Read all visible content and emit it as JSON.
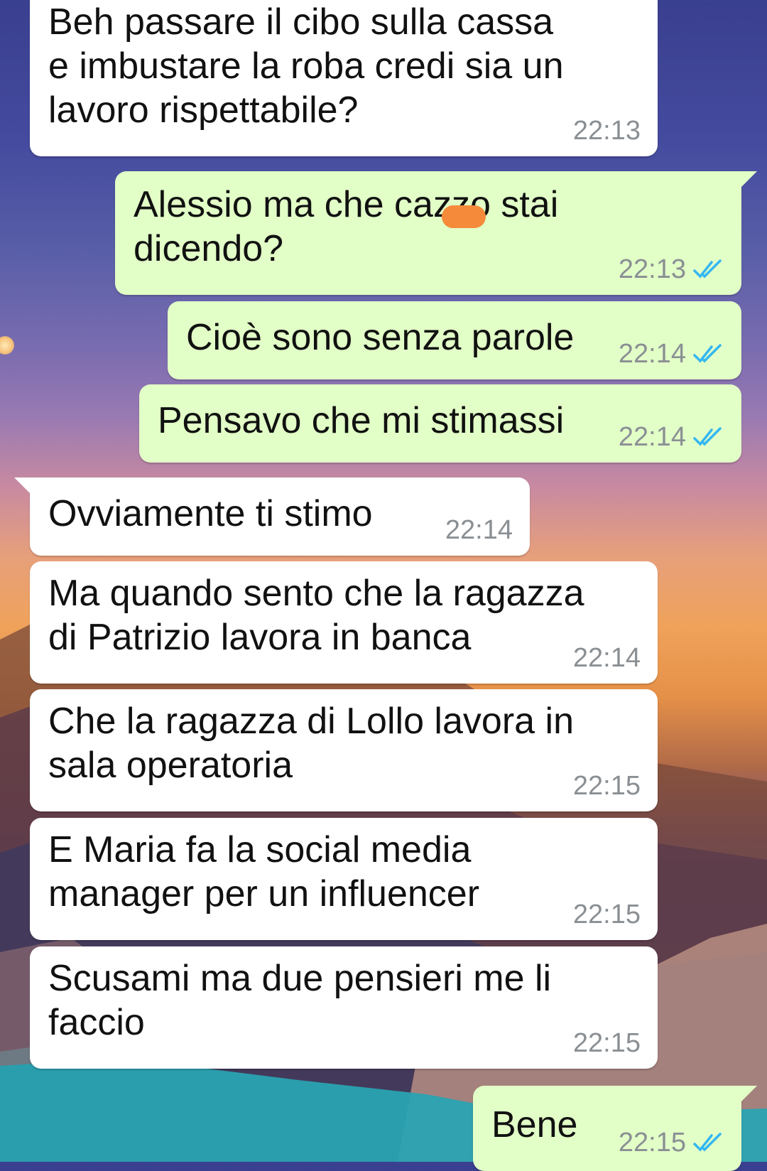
{
  "conversation": {
    "messages": [
      {
        "direction": "in",
        "text": "Beh passare il cibo sulla cassa\ne imbustare la roba credi sia un\nlavoro rispettabile?",
        "time": "22:13"
      },
      {
        "direction": "out",
        "text": "Alessio ma che cazzo stai\ndicendo?",
        "time": "22:13",
        "status": "read"
      },
      {
        "direction": "out",
        "text": "Cioè sono senza parole",
        "time": "22:14",
        "status": "read"
      },
      {
        "direction": "out",
        "text": "Pensavo che mi stimassi",
        "time": "22:14",
        "status": "read"
      },
      {
        "direction": "in",
        "text": "Ovviamente ti stimo",
        "time": "22:14"
      },
      {
        "direction": "in",
        "text": "Ma quando sento che la ragazza\ndi Patrizio lavora in banca",
        "time": "22:14"
      },
      {
        "direction": "in",
        "text": "Che la ragazza di Lollo lavora in\nsala operatoria",
        "time": "22:15"
      },
      {
        "direction": "in",
        "text": "E Maria fa la social media\nmanager per un influencer",
        "time": "22:15"
      },
      {
        "direction": "in",
        "text": "Scusami ma due pensieri me li\nfaccio",
        "time": "22:15"
      },
      {
        "direction": "out",
        "text": "Bene",
        "time": "22:15",
        "status": "read"
      }
    ]
  },
  "colors": {
    "incoming_bubble": "#ffffff",
    "outgoing_bubble": "#e2ffc7",
    "timestamp": "#8a8f94",
    "read_ticks": "#34b7f1",
    "censor_mark": "#f58a3a"
  },
  "icons": {
    "read_receipt": "double-check-icon"
  }
}
